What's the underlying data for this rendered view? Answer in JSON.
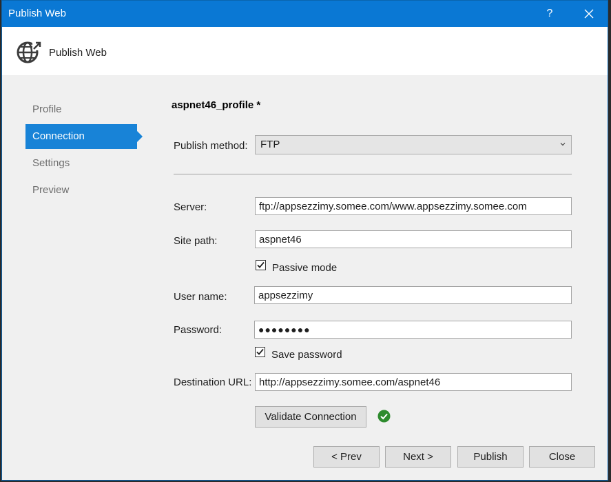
{
  "window": {
    "title": "Publish Web",
    "help_label": "?"
  },
  "header": {
    "title": "Publish Web",
    "icon": "globe-publish-icon"
  },
  "nav": {
    "items": [
      {
        "label": "Profile",
        "active": false
      },
      {
        "label": "Connection",
        "active": true
      },
      {
        "label": "Settings",
        "active": false
      },
      {
        "label": "Preview",
        "active": false
      }
    ]
  },
  "profile": {
    "name": "aspnet46_profile *"
  },
  "form": {
    "publish_method": {
      "label": "Publish method:",
      "value": "FTP"
    },
    "server": {
      "label": "Server:",
      "value": "ftp://appsezzimy.somee.com/www.appsezzimy.somee.com"
    },
    "site_path": {
      "label": "Site path:",
      "value": "aspnet46"
    },
    "passive_mode": {
      "label": "Passive mode",
      "checked": true
    },
    "user_name": {
      "label": "User name:",
      "value": "appsezzimy"
    },
    "password": {
      "label": "Password:",
      "value": "●●●●●●●●"
    },
    "save_password": {
      "label": "Save password",
      "checked": true
    },
    "destination_url": {
      "label": "Destination URL:",
      "value": "http://appsezzimy.somee.com/aspnet46"
    },
    "validate_button": "Validate Connection"
  },
  "footer": {
    "prev": "< Prev",
    "next": "Next >",
    "publish": "Publish",
    "close": "Close"
  },
  "colors": {
    "accent": "#0a78d4",
    "nav_active": "#1883d7",
    "success": "#2e8b2e"
  }
}
